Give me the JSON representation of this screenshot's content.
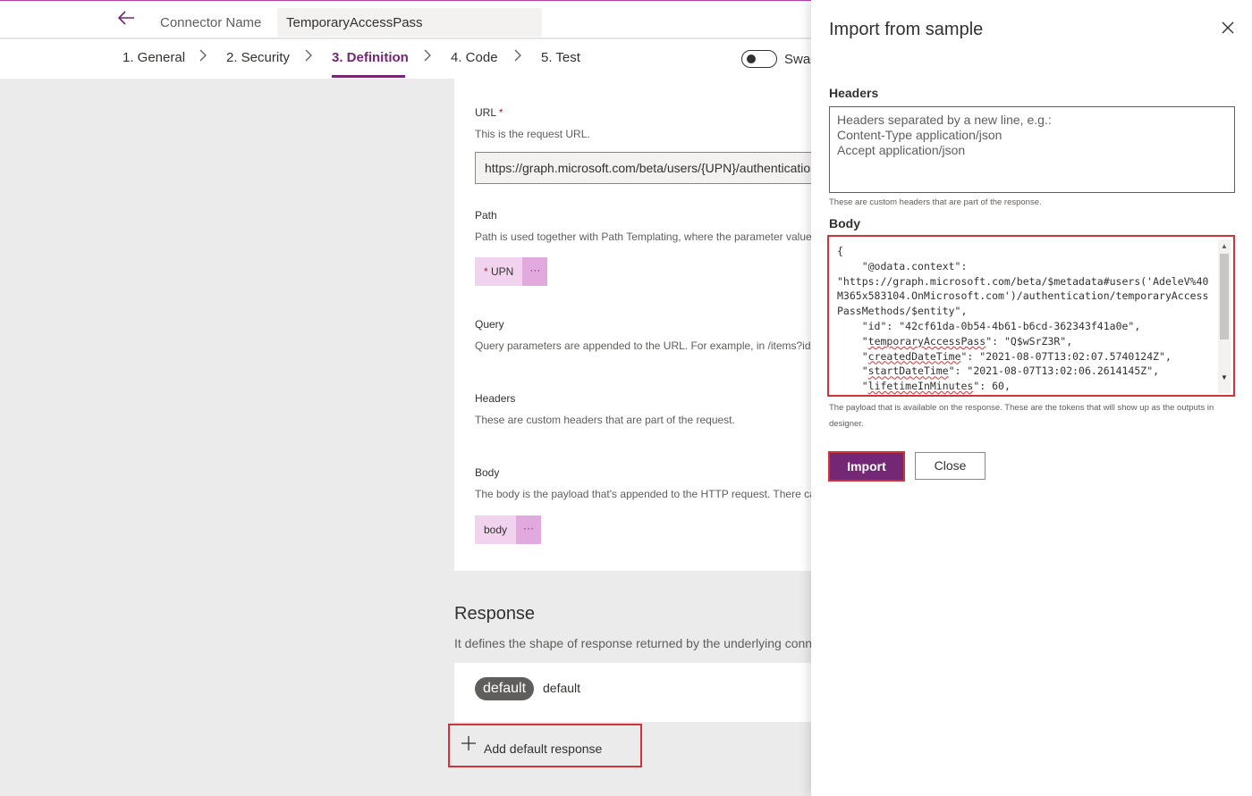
{
  "header": {
    "connector_label": "Connector Name",
    "connector_name": "TemporaryAccessPass"
  },
  "steps": [
    {
      "label": "1. General",
      "active": false
    },
    {
      "label": "2. Security",
      "active": false
    },
    {
      "label": "3. Definition",
      "active": true
    },
    {
      "label": "4. Code",
      "active": false
    },
    {
      "label": "5. Test",
      "active": false
    }
  ],
  "swagger_toggle": {
    "label": "Swag",
    "on": false
  },
  "definition": {
    "url": {
      "title": "URL",
      "required_mark": "*",
      "desc": "This is the request URL.",
      "value": "https://graph.microsoft.com/beta/users/{UPN}/authenticatio"
    },
    "path": {
      "title": "Path",
      "desc": "Path is used together with Path Templating, where the parameter value i",
      "chip_required": "*",
      "chip_label": "UPN",
      "chip_more": "···"
    },
    "query": {
      "title": "Query",
      "desc": "Query parameters are appended to the URL. For example, in /items?id=#"
    },
    "headers": {
      "title": "Headers",
      "desc": "These are custom headers that are part of the request."
    },
    "body": {
      "title": "Body",
      "desc": "The body is the payload that's appended to the HTTP request. There can",
      "chip_label": "body",
      "chip_more": "···"
    }
  },
  "response": {
    "title": "Response",
    "desc": "It defines the shape of response returned by the underlying conn",
    "pill": "default",
    "pill_text": "default",
    "add_default": "Add default response"
  },
  "panel": {
    "title": "Import from sample",
    "headers_label": "Headers",
    "headers_placeholder": "Headers separated by a new line, e.g.:\nContent-Type application/json\nAccept application/json",
    "headers_hint": "These are custom headers that are part of the response.",
    "body_label": "Body",
    "body_lines": {
      "l0": "{",
      "l1": "    \"@odata.context\":",
      "l2": "\"https://graph.microsoft.com/beta/$metadata#users('AdeleV%40M365x583104.OnMicrosoft.com')/authentication/temporaryAccessPassMethods/$entity\",",
      "l3": "    \"id\": \"42cf61da-0b54-4b61-b6cd-362343f41a0e\",",
      "l4_pre": "    \"",
      "l4_key": "temporaryAccessPass",
      "l4_post": "\": \"Q$wSrZ3R\",",
      "l5_pre": "    \"",
      "l5_key": "createdDateTime",
      "l5_post": "\": \"2021-08-07T13:02:07.5740124Z\",",
      "l6_pre": "    \"",
      "l6_key": "startDateTime",
      "l6_post": "\": \"2021-08-07T13:02:06.2614145Z\",",
      "l7_pre": "    \"",
      "l7_key": "lifetimeInMinutes",
      "l7_post": "\": 60,"
    },
    "body_hint": "The payload that is available on the response. These are the tokens that will show up as the outputs in designer.",
    "import_label": "Import",
    "close_label": "Close"
  },
  "colors": {
    "brand": "#742774",
    "highlight_border": "#d13438",
    "chip_bg": "#f1d3ef"
  },
  "icons": {
    "back": "arrow-left-icon",
    "chevron": "chevron-right-icon",
    "close": "close-icon",
    "plus": "plus-icon",
    "more": "ellipsis-icon"
  }
}
